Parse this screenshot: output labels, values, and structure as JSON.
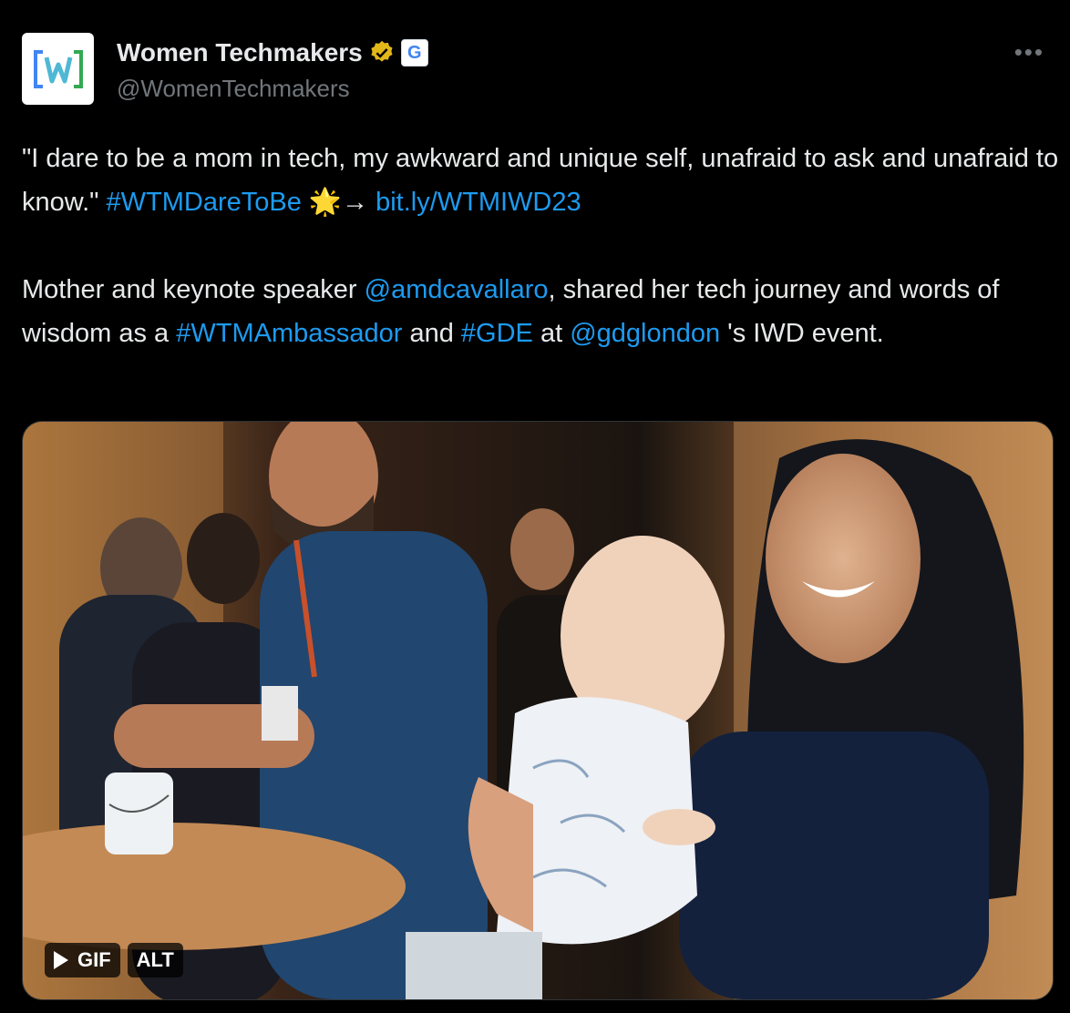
{
  "author": {
    "display_name": "Women Techmakers",
    "handle": "@WomenTechmakers",
    "affiliate_badge": "G",
    "verified_color": "#e2b719",
    "avatar_logo_text": "[W]"
  },
  "tweet": {
    "p1": {
      "t1": "\"I dare to be a mom in tech, my awkward and unique self, unafraid to ask and unafraid to know.\" ",
      "hashtag1": "#WTMDareToBe",
      "emoji": " 🌟→ ",
      "link": "bit.ly/WTMIWD23"
    },
    "p2": {
      "t1": "Mother and keynote speaker ",
      "mention1": "@amdcavallaro",
      "t2": ", shared her tech journey and words of wisdom as a ",
      "hashtag2": "#WTMAmbassador",
      "t3": " and ",
      "hashtag3": "#GDE",
      "t4": " at ",
      "mention2": "@gdglondon",
      "t5": " 's IWD event."
    }
  },
  "media": {
    "gif_label": "GIF",
    "alt_label": "ALT"
  },
  "icons": {
    "more": "more-options-icon",
    "verified": "verified-badge-icon",
    "play": "play-icon"
  },
  "colors": {
    "link": "#1d9bf0",
    "text": "#e7e9ea",
    "muted": "#71767b"
  }
}
